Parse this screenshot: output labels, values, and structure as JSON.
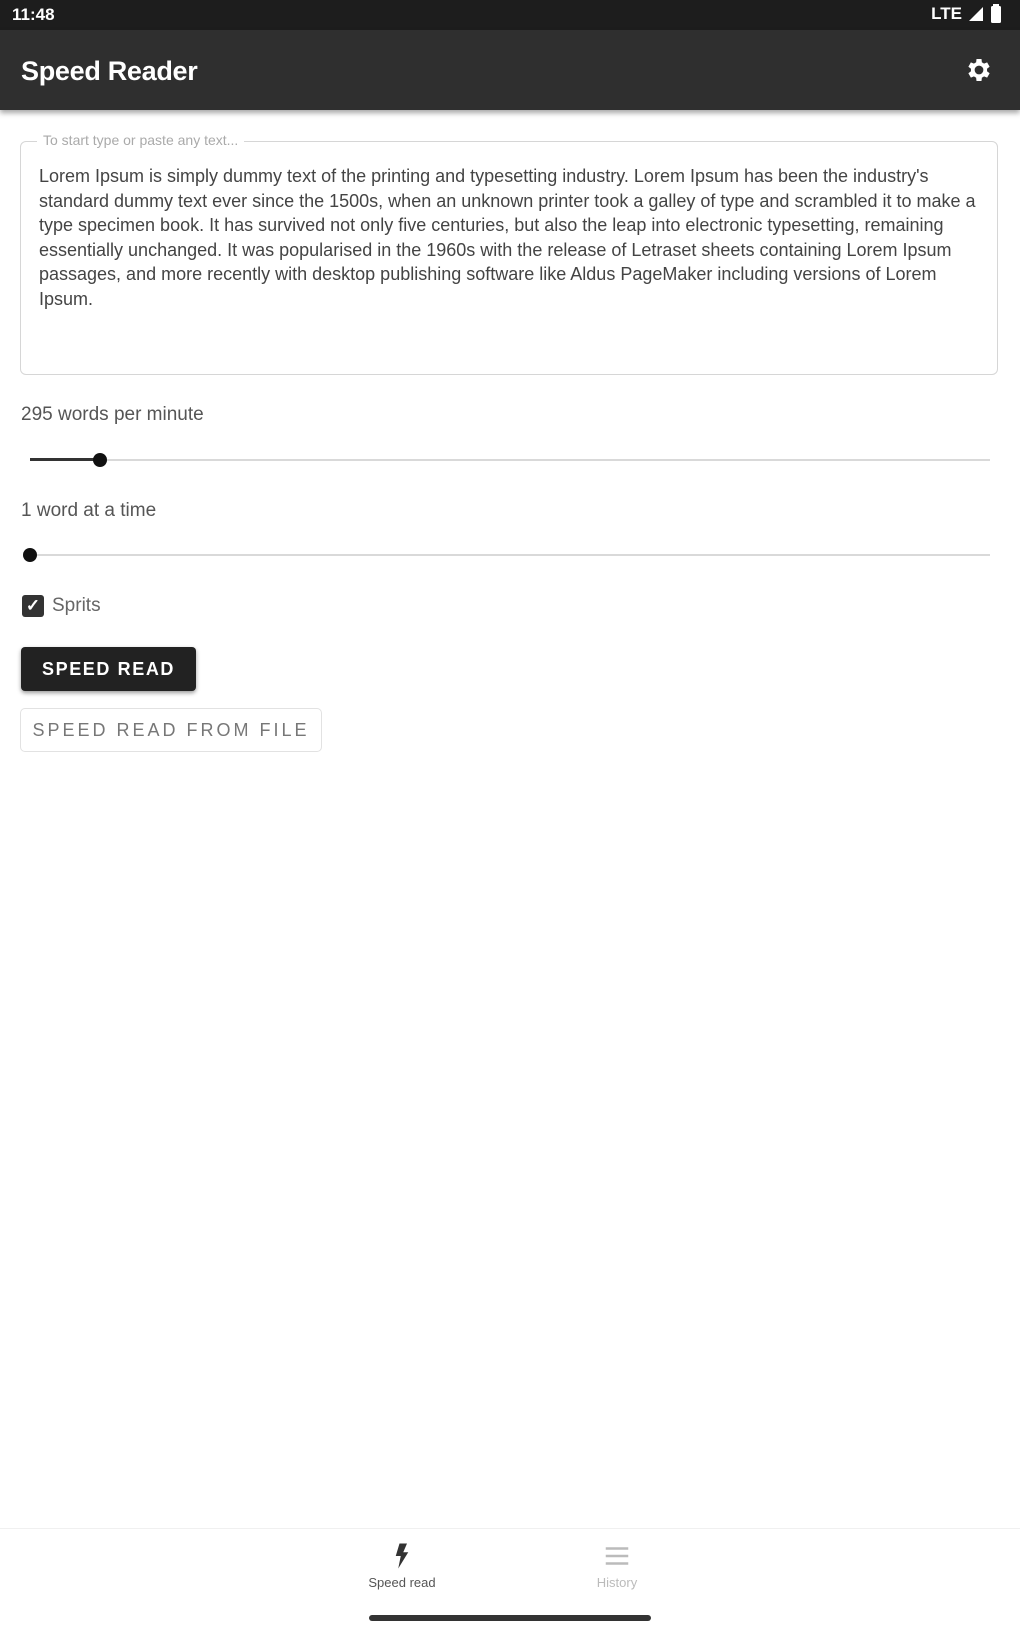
{
  "status_bar": {
    "time": "11:48",
    "network": "LTE"
  },
  "app_bar": {
    "title": "Speed Reader"
  },
  "text_field": {
    "label": "To start type or paste any text...",
    "value": "Lorem Ipsum is simply dummy text of the printing and typesetting industry. Lorem Ipsum has been the industry's standard dummy text ever since the 1500s, when an unknown printer took a galley of type and scrambled it to make a type specimen book. It has survived not only five centuries, but also the leap into electronic typesetting, remaining essentially unchanged. It was popularised in the 1960s with the release of Letraset sheets containing Lorem Ipsum passages, and more recently with desktop publishing software like Aldus PageMaker including versions of Lorem Ipsum."
  },
  "wpm": {
    "label": "295 words per minute",
    "fraction": 0.073
  },
  "chunk": {
    "label": "1 word at a time",
    "fraction": 0.0
  },
  "sprits": {
    "label": "Sprits",
    "checked": true
  },
  "buttons": {
    "speed_read": "SPEED READ",
    "speed_read_file": "SPEED READ FROM FILE"
  },
  "bottom_nav": [
    {
      "label": "Speed read",
      "icon": "speed-read-icon",
      "active": true
    },
    {
      "label": "History",
      "icon": "history-icon",
      "active": false
    }
  ]
}
